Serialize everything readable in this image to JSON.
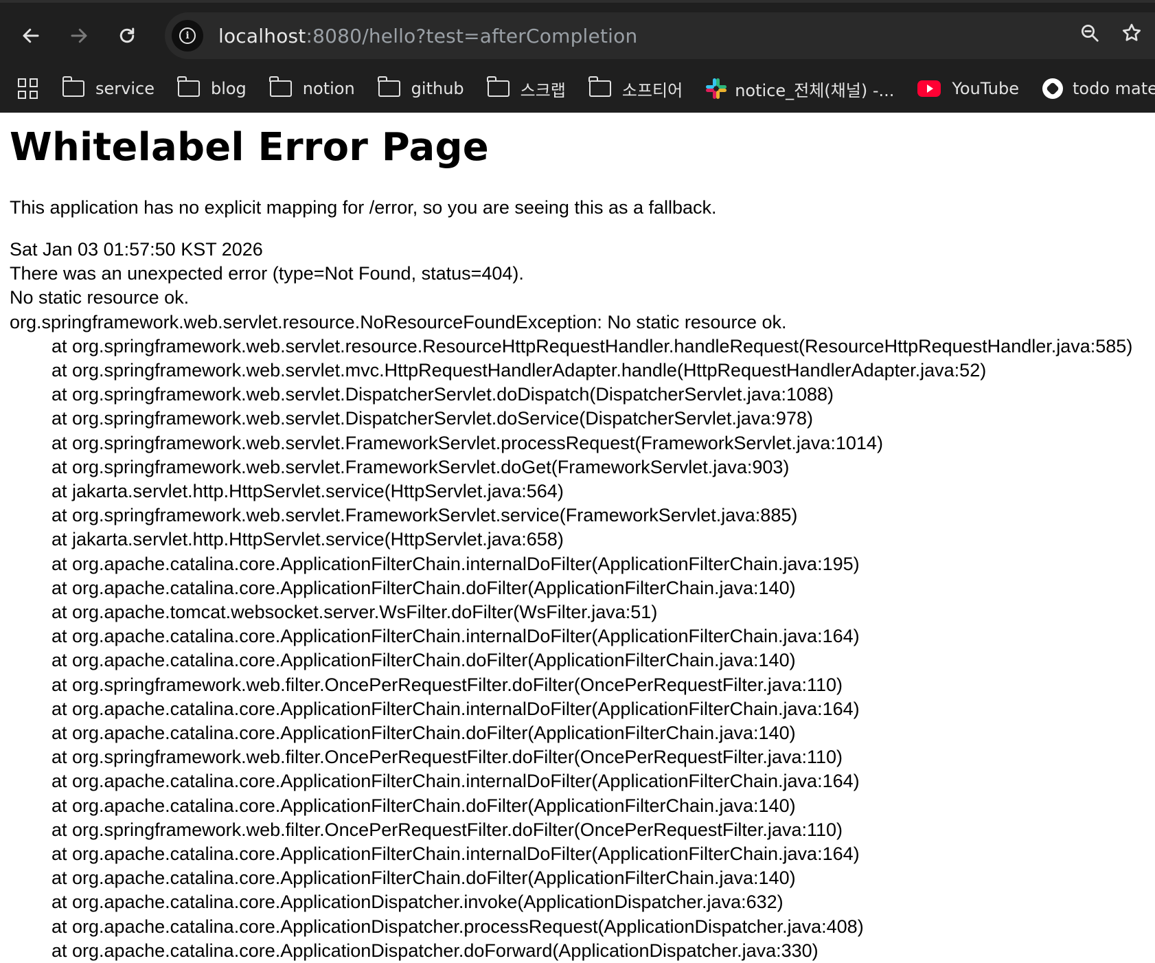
{
  "browser": {
    "url_host": "localhost",
    "url_rest": ":8080/hello?test=afterCompletion",
    "bookmarks": [
      {
        "label": "service",
        "icon": "folder-icon"
      },
      {
        "label": "blog",
        "icon": "folder-icon"
      },
      {
        "label": "notion",
        "icon": "folder-icon"
      },
      {
        "label": "github",
        "icon": "folder-icon"
      },
      {
        "label": "스크랩",
        "icon": "folder-icon"
      },
      {
        "label": "소프티어",
        "icon": "folder-icon"
      },
      {
        "label": "notice_전체(채널) -...",
        "icon": "slack-icon"
      },
      {
        "label": "YouTube",
        "icon": "youtube-icon"
      },
      {
        "label": "todo mate",
        "icon": "todo-mate-icon"
      }
    ]
  },
  "page": {
    "title": "Whitelabel Error Page",
    "description": "This application has no explicit mapping for /error, so you are seeing this as a fallback.",
    "timestamp": "Sat Jan 03 01:57:50 KST 2026",
    "error_line": "There was an unexpected error (type=Not Found, status=404).",
    "message": "No static resource ok.",
    "exception": "org.springframework.web.servlet.resource.NoResourceFoundException: No static resource ok.",
    "stack": [
      "at org.springframework.web.servlet.resource.ResourceHttpRequestHandler.handleRequest(ResourceHttpRequestHandler.java:585)",
      "at org.springframework.web.servlet.mvc.HttpRequestHandlerAdapter.handle(HttpRequestHandlerAdapter.java:52)",
      "at org.springframework.web.servlet.DispatcherServlet.doDispatch(DispatcherServlet.java:1088)",
      "at org.springframework.web.servlet.DispatcherServlet.doService(DispatcherServlet.java:978)",
      "at org.springframework.web.servlet.FrameworkServlet.processRequest(FrameworkServlet.java:1014)",
      "at org.springframework.web.servlet.FrameworkServlet.doGet(FrameworkServlet.java:903)",
      "at jakarta.servlet.http.HttpServlet.service(HttpServlet.java:564)",
      "at org.springframework.web.servlet.FrameworkServlet.service(FrameworkServlet.java:885)",
      "at jakarta.servlet.http.HttpServlet.service(HttpServlet.java:658)",
      "at org.apache.catalina.core.ApplicationFilterChain.internalDoFilter(ApplicationFilterChain.java:195)",
      "at org.apache.catalina.core.ApplicationFilterChain.doFilter(ApplicationFilterChain.java:140)",
      "at org.apache.tomcat.websocket.server.WsFilter.doFilter(WsFilter.java:51)",
      "at org.apache.catalina.core.ApplicationFilterChain.internalDoFilter(ApplicationFilterChain.java:164)",
      "at org.apache.catalina.core.ApplicationFilterChain.doFilter(ApplicationFilterChain.java:140)",
      "at org.springframework.web.filter.OncePerRequestFilter.doFilter(OncePerRequestFilter.java:110)",
      "at org.apache.catalina.core.ApplicationFilterChain.internalDoFilter(ApplicationFilterChain.java:164)",
      "at org.apache.catalina.core.ApplicationFilterChain.doFilter(ApplicationFilterChain.java:140)",
      "at org.springframework.web.filter.OncePerRequestFilter.doFilter(OncePerRequestFilter.java:110)",
      "at org.apache.catalina.core.ApplicationFilterChain.internalDoFilter(ApplicationFilterChain.java:164)",
      "at org.apache.catalina.core.ApplicationFilterChain.doFilter(ApplicationFilterChain.java:140)",
      "at org.springframework.web.filter.OncePerRequestFilter.doFilter(OncePerRequestFilter.java:110)",
      "at org.apache.catalina.core.ApplicationFilterChain.internalDoFilter(ApplicationFilterChain.java:164)",
      "at org.apache.catalina.core.ApplicationFilterChain.doFilter(ApplicationFilterChain.java:140)",
      "at org.apache.catalina.core.ApplicationDispatcher.invoke(ApplicationDispatcher.java:632)",
      "at org.apache.catalina.core.ApplicationDispatcher.processRequest(ApplicationDispatcher.java:408)",
      "at org.apache.catalina.core.ApplicationDispatcher.doForward(ApplicationDispatcher.java:330)"
    ]
  }
}
